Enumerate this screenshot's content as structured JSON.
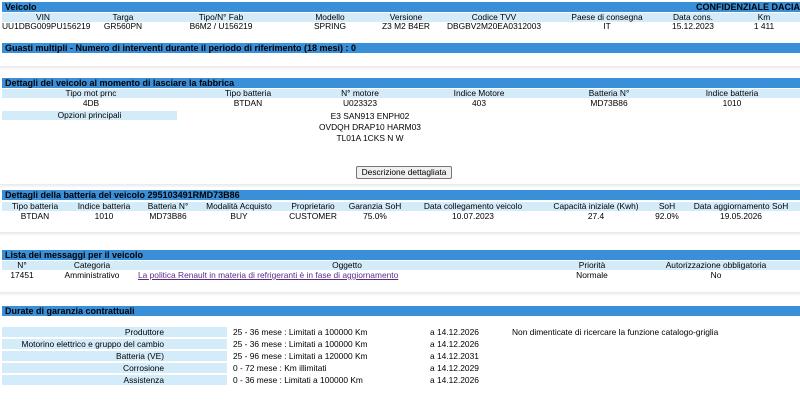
{
  "vehicle": {
    "title": "Veicolo",
    "confidential": "CONFIDENZIALE DACIA",
    "headers": [
      "VIN",
      "Targa",
      "Tipo/N° Fab",
      "Modello",
      "Versione",
      "Codice TVV",
      "Paese di consegna",
      "Data cons.",
      "Km"
    ],
    "values": [
      "UU1DBG009PU156219",
      "GR560PN",
      "B6M2 / U156219",
      "SPRING",
      "Z3 M2 B4ER",
      "DBGBV2M20EA0312003",
      "IT",
      "15.12.2023",
      "1 411"
    ]
  },
  "multiple_failures": "Guasti multipli - Numero di interventi durante il periodo di riferimento (18 mesi) : 0",
  "factory": {
    "title": "Dettagli del veicolo al momento di lasciare la fabbrica",
    "headers": [
      "Tipo mot prnc",
      "Tipo batteria",
      "N° motore",
      "Indice Motore",
      "Batteria N°",
      "Indice batteria"
    ],
    "values": [
      "4DB",
      "BTDAN",
      "U023323",
      "403",
      "MD73B86",
      "1010"
    ],
    "options_label": "Opzioni principali",
    "options_lines": [
      "E3 SAN913 ENPH02",
      "OVDQH DRAP10 HARM03",
      "TL01A 1CKS N W"
    ],
    "detail_button": "Descrizione dettagliata"
  },
  "battery": {
    "title": "Dettagli della batteria del veicolo 295103491RMD73B86",
    "headers": [
      "Tipo batteria",
      "Indice batteria",
      "Batteria N°",
      "Modalità Acquisto",
      "Proprietario",
      "Garanzia SoH",
      "Data collegamento veicolo",
      "Capacità iniziale (Kwh)",
      "SoH",
      "Data aggiornamento SoH"
    ],
    "values": [
      "BTDAN",
      "1010",
      "MD73B86",
      "BUY",
      "CUSTOMER",
      "75.0%",
      "10.07.2023",
      "27.4",
      "92.0%",
      "19.05.2026"
    ]
  },
  "messages": {
    "title": "Lista dei messaggi per il veicolo",
    "headers": [
      "N°",
      "Categoria",
      "Oggetto",
      "Priorità",
      "Autorizzazione obbligatoria"
    ],
    "rows": [
      {
        "num": "17451",
        "category": "Amministrativo",
        "subject": "La politica Renault in materia di refrigeranti è in fase di aggiornamento",
        "priority": "Normale",
        "auth": "No"
      }
    ]
  },
  "warranty": {
    "title": "Durate di garanzia contrattuali",
    "note": "Non dimenticate di ricercare la funzione catalogo-griglia",
    "rows": [
      {
        "label": "Produttore",
        "duration": "25 - 36 mese : Limitati a 100000 Km",
        "until": "a  14.12.2026"
      },
      {
        "label": "Motorino elettrico e gruppo del cambio",
        "duration": "25 - 36 mese : Limitati a 100000 Km",
        "until": "a  14.12.2026"
      },
      {
        "label": "Batteria (VE)",
        "duration": "25 - 96 mese : Limitati a 120000 Km",
        "until": "a  14.12.2031"
      },
      {
        "label": "Corrosione",
        "duration": "0 - 72 mese : Km illimitati",
        "until": "a  14.12.2029"
      },
      {
        "label": "Assistenza",
        "duration": "0 - 36 mese : Limitati a 100000 Km",
        "until": "a  14.12.2026"
      }
    ]
  }
}
